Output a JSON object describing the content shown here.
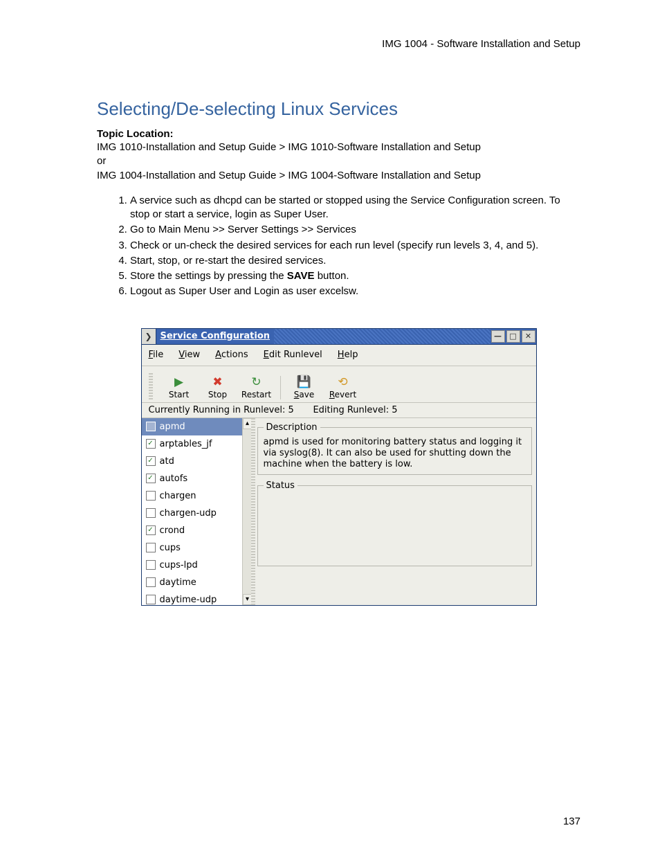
{
  "header": {
    "running": "IMG 1004 - Software Installation and Setup"
  },
  "title": "Selecting/De-selecting Linux Services",
  "topic": {
    "label": "Topic Location:",
    "line1": "IMG 1010-Installation and Setup Guide  >  IMG 1010-Software Installation and Setup",
    "or": "or",
    "line2": "IMG 1004-Installation and Setup Guide  >  IMG 1004-Software Installation and Setup"
  },
  "steps": [
    "A service such as dhcpd can be started or stopped using the Service Configuration screen. To stop or start a service, login as Super User.",
    "Go to Main Menu >> Server Settings >> Services",
    "Check or un-check the desired services for each run level (specify run levels 3, 4, and 5).",
    "Start, stop, or re-start the desired services.",
    {
      "pre": "Store the settings by pressing the ",
      "bold": "SAVE",
      "post": " button."
    },
    "Logout as Super User and Login as user excelsw."
  ],
  "screenshot": {
    "window_title": "Service Configuration",
    "menus": {
      "file": {
        "u": "F",
        "rest": "ile"
      },
      "view": {
        "u": "V",
        "rest": "iew"
      },
      "actions": {
        "u": "A",
        "rest": "ctions"
      },
      "edit": {
        "u": "E",
        "rest": "dit Runlevel"
      },
      "help": {
        "u": "H",
        "rest": "elp"
      }
    },
    "toolbar": {
      "start": "Start",
      "stop": "Stop",
      "restart": "Restart",
      "save": {
        "u": "S",
        "rest": "ave"
      },
      "revert": {
        "u": "R",
        "rest": "evert"
      }
    },
    "status": {
      "left": "Currently Running in Runlevel: 5",
      "right": "Editing Runlevel: 5"
    },
    "services": [
      {
        "name": "apmd",
        "checked": false,
        "selected": true
      },
      {
        "name": "arptables_jf",
        "checked": true,
        "selected": false
      },
      {
        "name": "atd",
        "checked": true,
        "selected": false
      },
      {
        "name": "autofs",
        "checked": true,
        "selected": false
      },
      {
        "name": "chargen",
        "checked": false,
        "selected": false
      },
      {
        "name": "chargen-udp",
        "checked": false,
        "selected": false
      },
      {
        "name": "crond",
        "checked": true,
        "selected": false
      },
      {
        "name": "cups",
        "checked": false,
        "selected": false
      },
      {
        "name": "cups-lpd",
        "checked": false,
        "selected": false
      },
      {
        "name": "daytime",
        "checked": false,
        "selected": false
      },
      {
        "name": "daytime-udp",
        "checked": false,
        "selected": false
      }
    ],
    "panels": {
      "description_label": "Description",
      "description_text": "apmd is used for monitoring battery status and logging it via syslog(8). It can also be used for shutting down the machine when the battery is low.",
      "status_label": "Status"
    }
  },
  "page_number": "137"
}
